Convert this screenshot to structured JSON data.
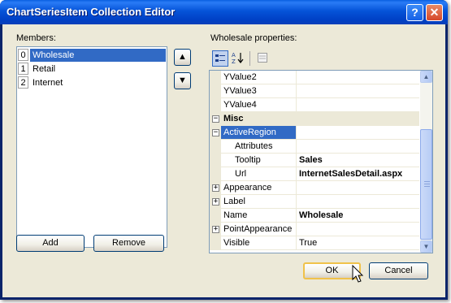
{
  "window": {
    "title": "ChartSeriesItem Collection Editor",
    "help_label": "?",
    "close_label": "✕"
  },
  "members": {
    "label": "Members:",
    "items": [
      {
        "index": "0",
        "name": "Wholesale",
        "selected": true
      },
      {
        "index": "1",
        "name": "Retail",
        "selected": false
      },
      {
        "index": "2",
        "name": "Internet",
        "selected": false
      }
    ],
    "move_up_icon": "▲",
    "move_down_icon": "▼",
    "add_label": "Add",
    "remove_label": "Remove"
  },
  "properties": {
    "label": "Wholesale properties:",
    "toolbar": {
      "categorized_icon": "categorized-icon",
      "alphabetical_icon": "alphabetical-icon",
      "property_pages_icon": "property-pages-icon"
    },
    "rows": [
      {
        "name": "YValue2",
        "value": ""
      },
      {
        "name": "YValue3",
        "value": ""
      },
      {
        "name": "YValue4",
        "value": ""
      },
      {
        "category": "Misc",
        "expander": "−"
      },
      {
        "name": "ActiveRegion",
        "value": "",
        "expander": "−",
        "selected": true
      },
      {
        "name": "Attributes",
        "value": "",
        "sub": true
      },
      {
        "name": "Tooltip",
        "value": "Sales",
        "bold": true,
        "sub": true
      },
      {
        "name": "Url",
        "value": "InternetSalesDetail.aspx",
        "bold": true,
        "sub": true
      },
      {
        "name": "Appearance",
        "value": "",
        "expander": "+"
      },
      {
        "name": "Label",
        "value": "",
        "expander": "+"
      },
      {
        "name": "Name",
        "value": "Wholesale",
        "bold": true
      },
      {
        "name": "PointAppearance",
        "value": "",
        "expander": "+"
      },
      {
        "name": "Visible",
        "value": "True"
      }
    ]
  },
  "footer": {
    "ok_label": "OK",
    "cancel_label": "Cancel"
  },
  "colors": {
    "titlebar": "#0553d8",
    "selection": "#316ac5",
    "dialog_bg": "#ece9d8"
  }
}
